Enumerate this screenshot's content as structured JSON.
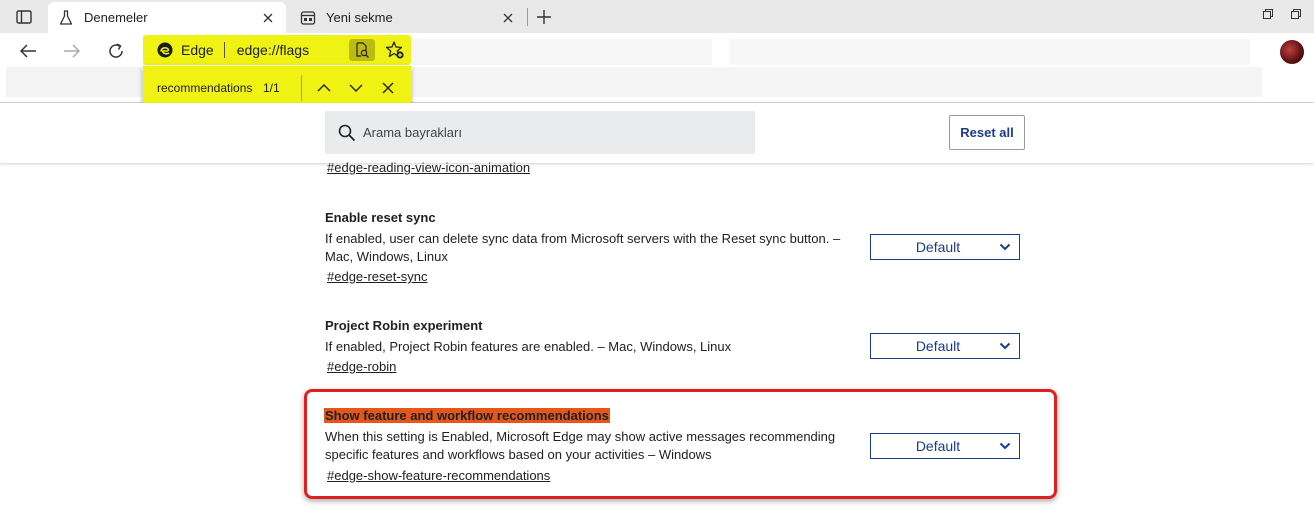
{
  "tabs": [
    {
      "title": "Denemeler",
      "icon": "flask-icon",
      "active": true
    },
    {
      "title": "Yeni sekme",
      "icon": "newtab-page-icon",
      "active": false
    }
  ],
  "address": {
    "label": "Edge",
    "url": "edge://flags"
  },
  "find": {
    "query": "recommendations",
    "count": "1/1"
  },
  "search": {
    "placeholder": "Arama bayrakları"
  },
  "header": {
    "reset_label": "Reset all"
  },
  "flags": [
    {
      "link": "#edge-reading-view-icon-animation"
    },
    {
      "title": "Enable reset sync",
      "description": "If enabled, user can delete sync data from Microsoft servers with the Reset sync button. – Mac, Windows, Linux",
      "link": "#edge-reset-sync",
      "value": "Default"
    },
    {
      "title": "Project Robin experiment",
      "description": "If enabled, Project Robin features are enabled. – Mac, Windows, Linux",
      "link": "#edge-robin",
      "value": "Default"
    },
    {
      "title": "Show feature and workflow recommendations",
      "description": "When this setting is Enabled, Microsoft Edge may show active messages recommending specific features and workflows based on your activities – Windows",
      "link": "#edge-show-feature-recommendations",
      "value": "Default"
    }
  ],
  "colors": {
    "highlight_yellow": "#f0f213",
    "find_match": "#e4571c",
    "annotation_red": "#e02020",
    "accent_blue": "#1a3d8a"
  }
}
